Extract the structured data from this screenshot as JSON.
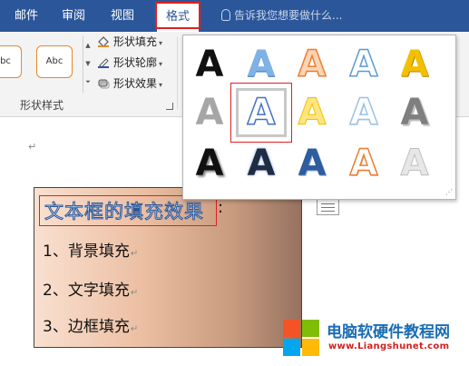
{
  "tabs": [
    "邮件",
    "审阅",
    "视图",
    "格式"
  ],
  "active_tab": "格式",
  "tell_me": {
    "text": "告诉我您想要做什么..."
  },
  "shape_styles": {
    "preview_labels": [
      "bc",
      "Abc"
    ],
    "scroll": [
      "▲",
      "▼",
      "⏷"
    ],
    "commands": [
      "形状填充",
      "形状轮廓",
      "形状效果"
    ],
    "group_label": "形状样式"
  },
  "wordart_gallery": {
    "glyph": "A",
    "styles": [
      {
        "name": "solid-black",
        "color": "#111111"
      },
      {
        "name": "blue-gradient",
        "color": "#5b9bd5"
      },
      {
        "name": "orange-outline",
        "color": "#f4b183"
      },
      {
        "name": "white-blue-outline",
        "color": "#ffffff"
      },
      {
        "name": "gold-gradient",
        "color": "#e8b800"
      },
      {
        "name": "gray-gradient",
        "color": "#a6a6a6"
      },
      {
        "name": "blue-outline-selected",
        "color": "#4472c4"
      },
      {
        "name": "yellow-light",
        "color": "#ffe57f"
      },
      {
        "name": "light-blue-outline",
        "color": "#ffffff"
      },
      {
        "name": "gray-bevel",
        "color": "#7f7f7f"
      },
      {
        "name": "black-shadow",
        "color": "#111111"
      },
      {
        "name": "dark-blue-glow",
        "color": "#1f2d44"
      },
      {
        "name": "blue-bevel",
        "color": "#2e5c9e"
      },
      {
        "name": "orange-white-outline",
        "color": "#ffffff"
      },
      {
        "name": "silver",
        "color": "#d9d9d9"
      }
    ],
    "selected_index": 6
  },
  "document": {
    "paragraph_mark": "↵",
    "textbox": {
      "title": "文本框的填充效果",
      "title_suffix": ":",
      "lines": [
        "1、背景填充",
        "2、文字填充",
        "3、边框填充"
      ]
    }
  },
  "watermark": {
    "site_name": "电脑软硬件教程网",
    "url": "www.Liangshunet.com",
    "colors": [
      "#f35325",
      "#81bc06",
      "#05a6f0",
      "#ffba08"
    ]
  }
}
